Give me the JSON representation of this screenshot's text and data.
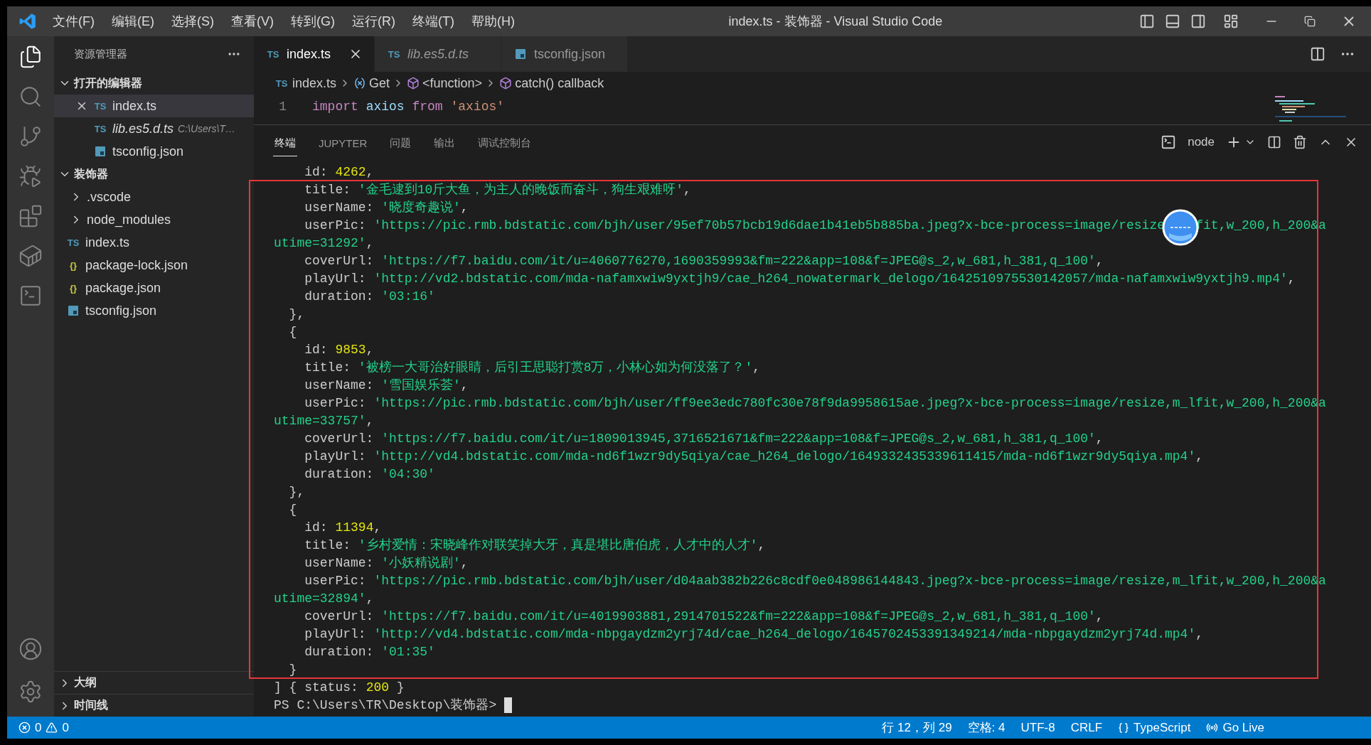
{
  "title_bar": {
    "menus": [
      "文件(F)",
      "编辑(E)",
      "选择(S)",
      "查看(V)",
      "转到(G)",
      "运行(R)",
      "终端(T)",
      "帮助(H)"
    ],
    "title": "index.ts - 装饰器 - Visual Studio Code"
  },
  "activity_bar": {
    "items": [
      {
        "kind": "explorer",
        "selected": true
      },
      {
        "kind": "search",
        "selected": false
      },
      {
        "kind": "scm",
        "selected": false
      },
      {
        "kind": "debug",
        "selected": false
      },
      {
        "kind": "extensions",
        "selected": false
      },
      {
        "kind": "docker",
        "selected": false
      },
      {
        "kind": "terminal",
        "selected": false
      }
    ],
    "bottom": [
      {
        "kind": "account"
      },
      {
        "kind": "settings"
      }
    ]
  },
  "sidebar": {
    "title": "资源管理器",
    "open_editors": {
      "label": "打开的编辑器",
      "expanded": true,
      "items": [
        {
          "name": "index.ts",
          "kind": "ts",
          "badge": "TS",
          "selected": true,
          "preview": false
        },
        {
          "name": "lib.es5.d.ts",
          "kind": "ts",
          "badge": "TS",
          "selected": false,
          "preview": true,
          "description": "C:\\Users\\T…"
        },
        {
          "name": "tsconfig.json",
          "kind": "tsconfig",
          "selected": false,
          "preview": false
        }
      ]
    },
    "folder": {
      "label": "装饰器",
      "expanded": true,
      "children": [
        {
          "name": ".vscode",
          "kind": "folder",
          "expanded": false
        },
        {
          "name": "node_modules",
          "kind": "folder",
          "expanded": false
        },
        {
          "name": "index.ts",
          "kind": "ts",
          "badge": "TS"
        },
        {
          "name": "package-lock.json",
          "kind": "json",
          "badge": "{}"
        },
        {
          "name": "package.json",
          "kind": "json",
          "badge": "{}"
        },
        {
          "name": "tsconfig.json",
          "kind": "tsconfig"
        }
      ]
    },
    "bottom_sections": [
      {
        "label": "大纲",
        "expanded": false
      },
      {
        "label": "时间线",
        "expanded": false
      }
    ]
  },
  "editor": {
    "tabs": [
      {
        "name": "index.ts",
        "kind": "ts",
        "badge": "TS",
        "selected": true,
        "preview": false
      },
      {
        "name": "lib.es5.d.ts",
        "kind": "ts",
        "badge": "TS",
        "selected": false,
        "preview": true
      },
      {
        "name": "tsconfig.json",
        "kind": "tsconfig",
        "selected": false,
        "preview": false
      }
    ],
    "breadcrumb": [
      {
        "kind": "file",
        "badge": "TS",
        "label": "index.ts"
      },
      {
        "kind": "variable",
        "label": "Get"
      },
      {
        "kind": "function",
        "label": "<function>"
      },
      {
        "kind": "function",
        "label": "catch() callback"
      }
    ],
    "lines": [
      {
        "number": "1",
        "tokens": [
          {
            "kind": "keyword",
            "text": "import "
          },
          {
            "kind": "variable",
            "text": "axios "
          },
          {
            "kind": "keyword",
            "text": "from "
          },
          {
            "kind": "string",
            "text": "'axios'"
          }
        ]
      }
    ]
  },
  "panel": {
    "tabs": [
      {
        "label": "终端",
        "selected": true
      },
      {
        "label": "JUPYTER",
        "selected": false
      },
      {
        "label": "问题",
        "selected": false
      },
      {
        "label": "输出",
        "selected": false
      },
      {
        "label": "调试控制台",
        "selected": false
      }
    ],
    "terminal_name": "node",
    "cursor": true,
    "lines": [
      [
        {
          "kind": "plain",
          "text": "    id: "
        },
        {
          "kind": "number",
          "text": "4262"
        },
        {
          "kind": "plain",
          "text": ","
        }
      ],
      [
        {
          "kind": "plain",
          "text": "    title: "
        },
        {
          "kind": "string",
          "text": "'金毛逮到10斤大鱼，为主人的晚饭而奋斗，狗生艰难呀'"
        },
        {
          "kind": "plain",
          "text": ","
        }
      ],
      [
        {
          "kind": "plain",
          "text": "    userName: "
        },
        {
          "kind": "string",
          "text": "'晓度奇趣说'"
        },
        {
          "kind": "plain",
          "text": ","
        }
      ],
      [
        {
          "kind": "plain",
          "text": "    userPic: "
        },
        {
          "kind": "string",
          "text": "'https://pic.rmb.bdstatic.com/bjh/user/95ef70b57bcb19d6dae1b41eb5b885ba.jpeg?x-bce-process=image/resize"
        },
        {
          "kind": "covered"
        },
        {
          "kind": "string",
          "text": "fit,w_200,h_200&a"
        }
      ],
      [
        {
          "kind": "string",
          "text": "utime=31292'"
        },
        {
          "kind": "plain",
          "text": ","
        }
      ],
      [
        {
          "kind": "plain",
          "text": "    coverUrl: "
        },
        {
          "kind": "string",
          "text": "'https://f7.baidu.com/it/u=4060776270,1690359993&fm=222&app=108&f=JPEG@s_2,w_681,h_381,q_100'"
        },
        {
          "kind": "plain",
          "text": ","
        }
      ],
      [
        {
          "kind": "plain",
          "text": "    playUrl: "
        },
        {
          "kind": "string",
          "text": "'http://vd2.bdstatic.com/mda-nafamxwiw9yxtjh9/cae_h264_nowatermark_delogo/1642510975530142057/mda-nafamxwiw9yxtjh9.mp4'"
        },
        {
          "kind": "plain",
          "text": ","
        }
      ],
      [
        {
          "kind": "plain",
          "text": "    duration: "
        },
        {
          "kind": "string",
          "text": "'03:16'"
        }
      ],
      [
        {
          "kind": "plain",
          "text": "  },"
        }
      ],
      [
        {
          "kind": "plain",
          "text": "  {"
        }
      ],
      [
        {
          "kind": "plain",
          "text": "    id: "
        },
        {
          "kind": "number",
          "text": "9853"
        },
        {
          "kind": "plain",
          "text": ","
        }
      ],
      [
        {
          "kind": "plain",
          "text": "    title: "
        },
        {
          "kind": "string",
          "text": "'被榜一大哥治好眼睛，后引王思聪打赏8万，小林心如为何没落了？'"
        },
        {
          "kind": "plain",
          "text": ","
        }
      ],
      [
        {
          "kind": "plain",
          "text": "    userName: "
        },
        {
          "kind": "string",
          "text": "'雪国娱乐荟'"
        },
        {
          "kind": "plain",
          "text": ","
        }
      ],
      [
        {
          "kind": "plain",
          "text": "    userPic: "
        },
        {
          "kind": "string",
          "text": "'https://pic.rmb.bdstatic.com/bjh/user/ff9ee3edc780fc30e78f9da9958615ae.jpeg?x-bce-process=image/resize,m_lfit,w_200,h_200&a"
        }
      ],
      [
        {
          "kind": "string",
          "text": "utime=33757'"
        },
        {
          "kind": "plain",
          "text": ","
        }
      ],
      [
        {
          "kind": "plain",
          "text": "    coverUrl: "
        },
        {
          "kind": "string",
          "text": "'https://f7.baidu.com/it/u=1809013945,3716521671&fm=222&app=108&f=JPEG@s_2,w_681,h_381,q_100'"
        },
        {
          "kind": "plain",
          "text": ","
        }
      ],
      [
        {
          "kind": "plain",
          "text": "    playUrl: "
        },
        {
          "kind": "string",
          "text": "'http://vd4.bdstatic.com/mda-nd6f1wzr9dy5qiya/cae_h264_delogo/1649332435339611415/mda-nd6f1wzr9dy5qiya.mp4'"
        },
        {
          "kind": "plain",
          "text": ","
        }
      ],
      [
        {
          "kind": "plain",
          "text": "    duration: "
        },
        {
          "kind": "string",
          "text": "'04:30'"
        }
      ],
      [
        {
          "kind": "plain",
          "text": "  },"
        }
      ],
      [
        {
          "kind": "plain",
          "text": "  {"
        }
      ],
      [
        {
          "kind": "plain",
          "text": "    id: "
        },
        {
          "kind": "number",
          "text": "11394"
        },
        {
          "kind": "plain",
          "text": ","
        }
      ],
      [
        {
          "kind": "plain",
          "text": "    title: "
        },
        {
          "kind": "string",
          "text": "'乡村爱情：宋晓峰作对联笑掉大牙，真是堪比唐伯虎，人才中的人才'"
        },
        {
          "kind": "plain",
          "text": ","
        }
      ],
      [
        {
          "kind": "plain",
          "text": "    userName: "
        },
        {
          "kind": "string",
          "text": "'小妖精说剧'"
        },
        {
          "kind": "plain",
          "text": ","
        }
      ],
      [
        {
          "kind": "plain",
          "text": "    userPic: "
        },
        {
          "kind": "string",
          "text": "'https://pic.rmb.bdstatic.com/bjh/user/d04aab382b226c8cdf0e048986144843.jpeg?x-bce-process=image/resize,m_lfit,w_200,h_200&a"
        }
      ],
      [
        {
          "kind": "string",
          "text": "utime=32894'"
        },
        {
          "kind": "plain",
          "text": ","
        }
      ],
      [
        {
          "kind": "plain",
          "text": "    coverUrl: "
        },
        {
          "kind": "string",
          "text": "'https://f7.baidu.com/it/u=4019903881,2914701522&fm=222&app=108&f=JPEG@s_2,w_681,h_381,q_100'"
        },
        {
          "kind": "plain",
          "text": ","
        }
      ],
      [
        {
          "kind": "plain",
          "text": "    playUrl: "
        },
        {
          "kind": "string",
          "text": "'http://vd4.bdstatic.com/mda-nbpgaydzm2yrj74d/cae_h264_delogo/1645702453391349214/mda-nbpgaydzm2yrj74d.mp4'"
        },
        {
          "kind": "plain",
          "text": ","
        }
      ],
      [
        {
          "kind": "plain",
          "text": "    duration: "
        },
        {
          "kind": "string",
          "text": "'01:35'"
        }
      ],
      [
        {
          "kind": "plain",
          "text": "  }"
        }
      ],
      [
        {
          "kind": "plain",
          "text": "] { status: "
        },
        {
          "kind": "number",
          "text": "200"
        },
        {
          "kind": "plain",
          "text": " }"
        }
      ],
      [
        {
          "kind": "plain",
          "text": "PS C:\\Users\\TR\\Desktop\\装饰器> "
        }
      ]
    ]
  },
  "status_bar": {
    "errors": "0",
    "warnings": "0",
    "items": [
      {
        "kind": "text",
        "label": "行 12，列 29"
      },
      {
        "kind": "text",
        "label": "空格: 4"
      },
      {
        "kind": "text",
        "label": "UTF-8"
      },
      {
        "kind": "text",
        "label": "CRLF"
      },
      {
        "kind": "language",
        "label": "TypeScript"
      },
      {
        "kind": "live",
        "label": "Go Live"
      }
    ]
  }
}
